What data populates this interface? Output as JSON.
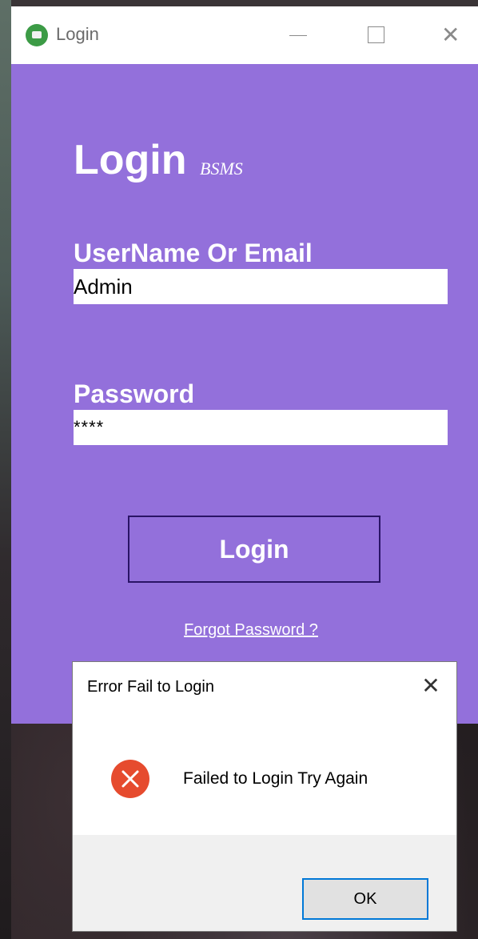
{
  "window": {
    "title": "Login",
    "minimize_glyph": "—",
    "maximize_glyph": "☐",
    "close_glyph": "✕"
  },
  "login_form": {
    "heading": "Login",
    "heading_sub": "BSMS",
    "username_label": "UserName Or Email",
    "username_value": "Admin",
    "password_label": "Password",
    "password_value": "****",
    "login_button": "Login",
    "forgot_link": "Forgot Password ?"
  },
  "error_dialog": {
    "title": "Error Fail to Login",
    "close_glyph": "✕",
    "message": "Failed to Login Try Again",
    "ok_button": "OK"
  },
  "colors": {
    "panel_background": "#9370db",
    "login_button_border": "#2a1466",
    "error_icon": "#e64b2e",
    "ok_button_border": "#0078d7",
    "app_icon": "#3c9b46"
  },
  "icons": {
    "app_icon": "app-icon",
    "error_icon": "error-icon"
  }
}
